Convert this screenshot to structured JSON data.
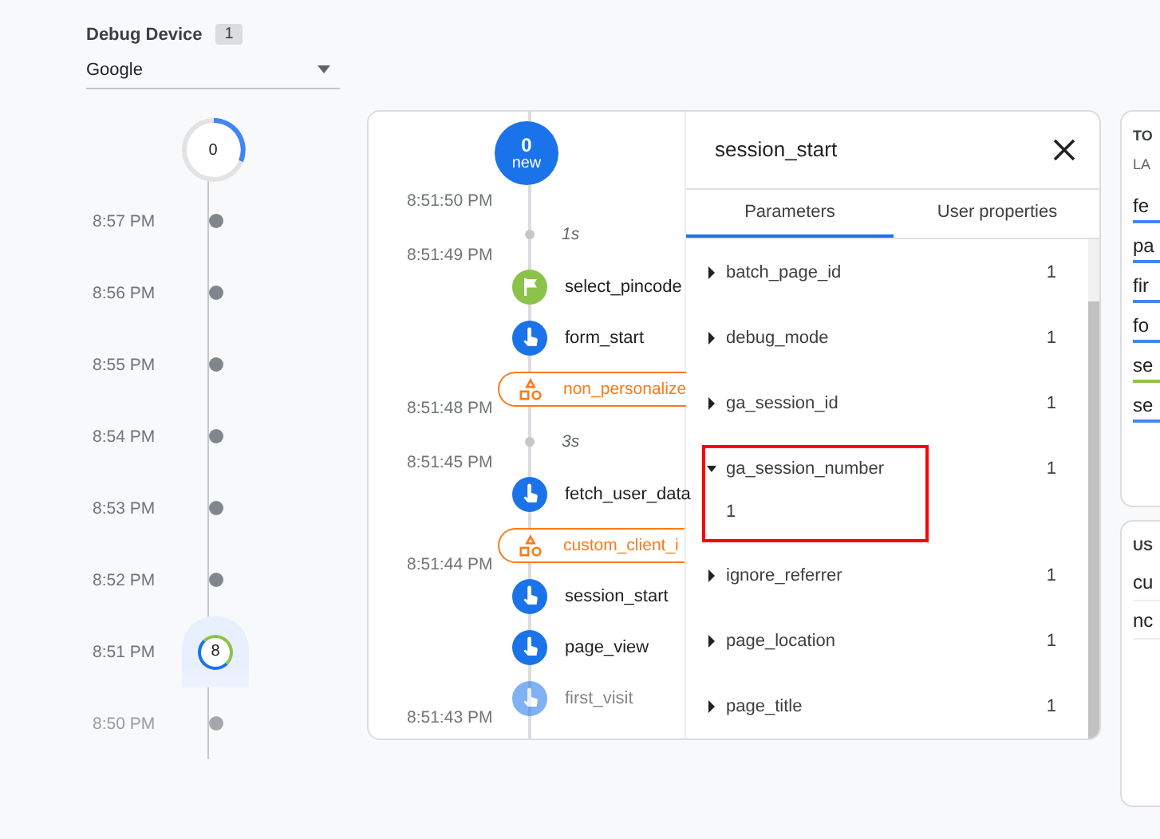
{
  "device": {
    "label": "Debug Device",
    "count": "1",
    "selected": "Google"
  },
  "minutes": {
    "counter": "0",
    "rows": [
      {
        "time": "8:57 PM",
        "selected": false,
        "faded": false
      },
      {
        "time": "8:56 PM",
        "selected": false,
        "faded": false
      },
      {
        "time": "8:55 PM",
        "selected": false,
        "faded": false
      },
      {
        "time": "8:54 PM",
        "selected": false,
        "faded": false
      },
      {
        "time": "8:53 PM",
        "selected": false,
        "faded": false
      },
      {
        "time": "8:52 PM",
        "selected": false,
        "faded": false
      },
      {
        "time": "8:51 PM",
        "selected": true,
        "count": "8",
        "faded": false
      },
      {
        "time": "8:50 PM",
        "selected": false,
        "faded": true
      }
    ]
  },
  "events": {
    "new_count": "0",
    "new_label": "new",
    "items": [
      {
        "kind": "time",
        "text": "8:51:50 PM"
      },
      {
        "kind": "gap",
        "text": "1s"
      },
      {
        "kind": "time",
        "text": "8:51:49 PM"
      },
      {
        "kind": "flag",
        "name": "select_pincode",
        "faded": false
      },
      {
        "kind": "event",
        "name": "form_start",
        "faded": false
      },
      {
        "kind": "pill",
        "name": "non_personalize"
      },
      {
        "kind": "time",
        "text": "8:51:48 PM"
      },
      {
        "kind": "gap",
        "text": "3s"
      },
      {
        "kind": "time",
        "text": "8:51:45 PM"
      },
      {
        "kind": "event",
        "name": "fetch_user_data",
        "faded": false
      },
      {
        "kind": "pill",
        "name": "custom_client_i"
      },
      {
        "kind": "time",
        "text": "8:51:44 PM"
      },
      {
        "kind": "event",
        "name": "session_start",
        "faded": false
      },
      {
        "kind": "event",
        "name": "page_view",
        "faded": false
      },
      {
        "kind": "event",
        "name": "first_visit",
        "faded": true
      },
      {
        "kind": "time",
        "text": "8:51:43 PM"
      }
    ]
  },
  "detail": {
    "title": "session_start",
    "tabs": [
      {
        "label": "Parameters",
        "selected": true
      },
      {
        "label": "User properties",
        "selected": false
      }
    ],
    "params": [
      {
        "name": "batch_page_id",
        "count": "1",
        "expanded": false,
        "highlighted": false
      },
      {
        "name": "debug_mode",
        "count": "1",
        "expanded": false,
        "highlighted": false
      },
      {
        "name": "ga_session_id",
        "count": "1",
        "expanded": false,
        "highlighted": false
      },
      {
        "name": "ga_session_number",
        "count": "1",
        "expanded": true,
        "value": "1",
        "highlighted": true
      },
      {
        "name": "ignore_referrer",
        "count": "1",
        "expanded": false,
        "highlighted": false
      },
      {
        "name": "page_location",
        "count": "1",
        "expanded": false,
        "highlighted": false
      },
      {
        "name": "page_title",
        "count": "1",
        "expanded": false,
        "highlighted": false
      }
    ]
  },
  "side_cards": [
    {
      "title": "TO",
      "subtitle": "LA",
      "items": [
        {
          "text": "fe",
          "color": "#4285f4"
        },
        {
          "text": "pa",
          "color": "#4285f4"
        },
        {
          "text": "fir",
          "color": "#4285f4"
        },
        {
          "text": "fo",
          "color": "#4285f4"
        },
        {
          "text": "se",
          "color": "#8bc34a"
        },
        {
          "text": "se",
          "color": "#4285f4"
        }
      ]
    },
    {
      "title": "US",
      "items": [
        {
          "text": "cu"
        },
        {
          "text": "nc"
        }
      ]
    }
  ]
}
